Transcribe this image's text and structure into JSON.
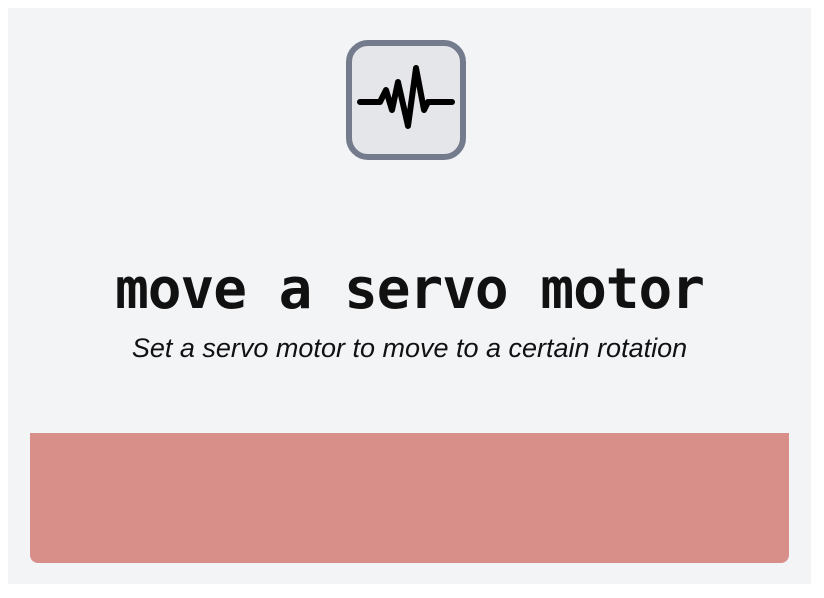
{
  "block": {
    "icon": "pulse-waveform-icon",
    "title": "move a servo motor",
    "description": "Set a servo motor to move to a certain rotation"
  },
  "colors": {
    "card_background": "#f3f4f6",
    "icon_border": "#737b8c",
    "icon_background": "#e5e6ea",
    "panel": "#d88f8a",
    "text": "#111111"
  }
}
